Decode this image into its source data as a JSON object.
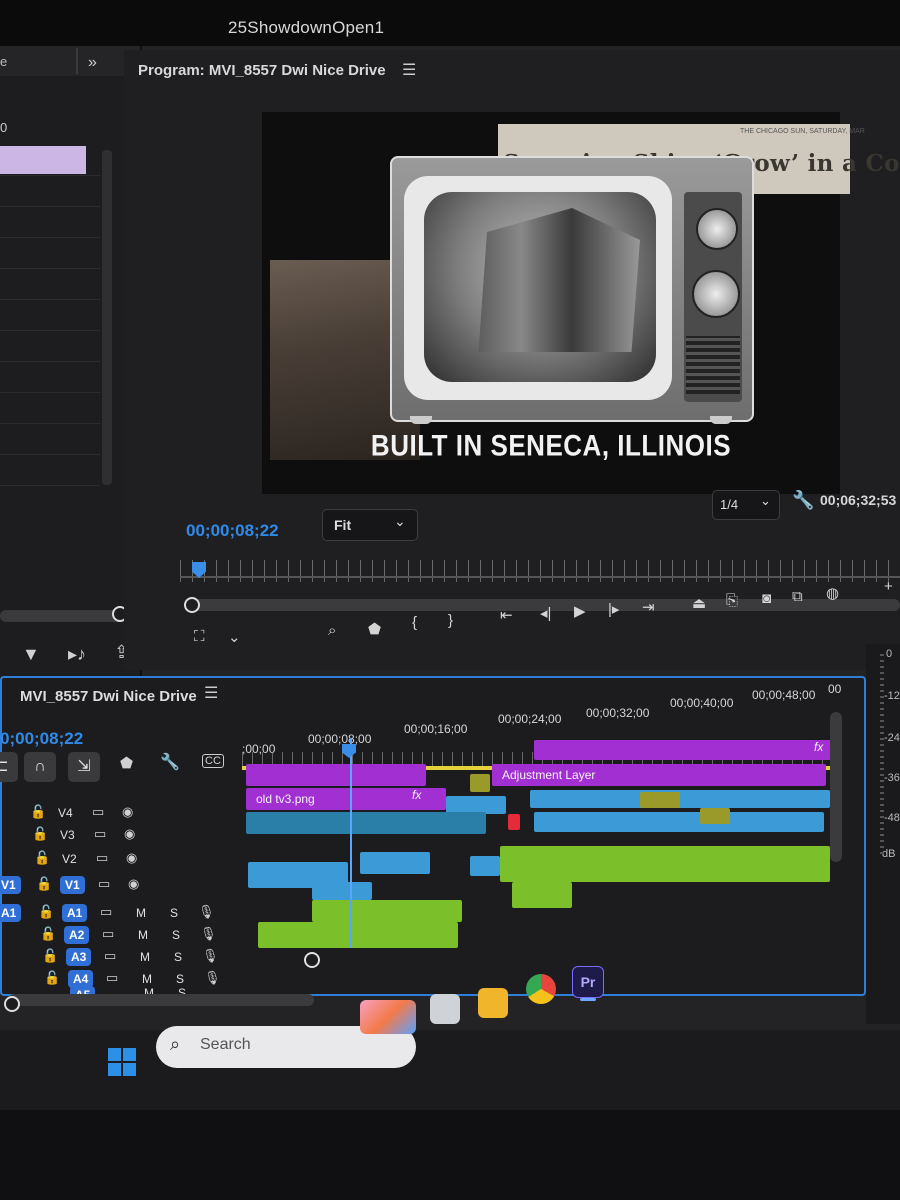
{
  "window": {
    "title": "25ShowdownOpen1"
  },
  "left_panel": {
    "tab_fragment": "e",
    "chevrons": "»",
    "count_fragment": "0",
    "tools": {
      "filter": "filter-icon",
      "music": "music-icon",
      "export": "export-icon"
    }
  },
  "program_monitor": {
    "title": "Program: MVI_8557 Dwi Nice Drive",
    "menu_icon": "☰",
    "news_small": "THE CHICAGO SUN, SATURDAY, MAR",
    "news_headline": "Seagoing Ships ‘Grow’ in a Cornf",
    "caption": "BUILT IN SENECA, ILLINOIS",
    "current_timecode": "00;00;08;22",
    "zoom": "Fit",
    "resolution": "1/4",
    "duration_timecode": "00;06;32;53"
  },
  "timeline": {
    "sequence_name": "MVI_8557 Dwi Nice Drive",
    "menu_icon": "☰",
    "current_timecode": "0;00;08;22",
    "ruler_ticks": [
      ";00;00",
      "00;00;08;00",
      "00;00;16;00",
      "00;00;24;00",
      "00;00;32;00",
      "00;00;40;00",
      "00;00;48;00",
      "00"
    ],
    "video_tracks": [
      {
        "name": "V4"
      },
      {
        "name": "V3"
      },
      {
        "name": "V2"
      },
      {
        "name": "V1",
        "source": "V1",
        "target": "V1"
      }
    ],
    "audio_tracks": [
      {
        "name": "A1",
        "source": "A1",
        "m": "M",
        "s": "S"
      },
      {
        "name": "A2",
        "m": "M",
        "s": "S"
      },
      {
        "name": "A3",
        "m": "M",
        "s": "S"
      },
      {
        "name": "A4",
        "m": "M",
        "s": "S"
      },
      {
        "name": "A5",
        "m": "M",
        "s": "S"
      }
    ],
    "clip_labels": {
      "adjustment": "Adjustment Layer",
      "old_tv": "old tv3.png",
      "fx1": "fx",
      "fx2": "fx"
    }
  },
  "audio_meter": {
    "labels": [
      "0",
      "-12",
      "-24",
      "-36",
      "-48"
    ],
    "unit": "dB"
  },
  "taskbar": {
    "search_placeholder": "Search",
    "pinned": [
      "file-explorer",
      "chrome",
      "premiere-pro"
    ],
    "premiere_label": "Pr"
  },
  "colors": {
    "accent_blue": "#2f8ae9",
    "clip_purple": "#a12fd1",
    "clip_blue": "#3c9bd6",
    "clip_green": "#7bbf2a",
    "work_area": "#e5d23a"
  }
}
